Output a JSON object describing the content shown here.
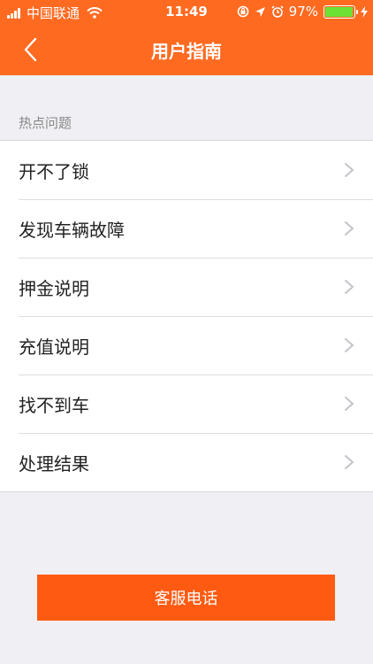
{
  "status_bar": {
    "carrier": "中国联通",
    "time": "11:49",
    "battery": "97%",
    "battery_level": 0.97,
    "icons": [
      "signal-icon",
      "wifi-icon",
      "rotation-lock-icon",
      "location-icon",
      "alarm-icon",
      "battery-icon",
      "charging-icon"
    ]
  },
  "header": {
    "title": "用户指南",
    "back_icon": "back-chevron-icon",
    "background": "#ff6a21"
  },
  "section": {
    "label": "热点问题"
  },
  "items": [
    {
      "label": "开不了锁"
    },
    {
      "label": "发现车辆故障"
    },
    {
      "label": "押金说明"
    },
    {
      "label": "充值说明"
    },
    {
      "label": "找不到车"
    },
    {
      "label": "处理结果"
    }
  ],
  "footer": {
    "button_label": "客服电话",
    "button_color": "#ff5a12"
  }
}
